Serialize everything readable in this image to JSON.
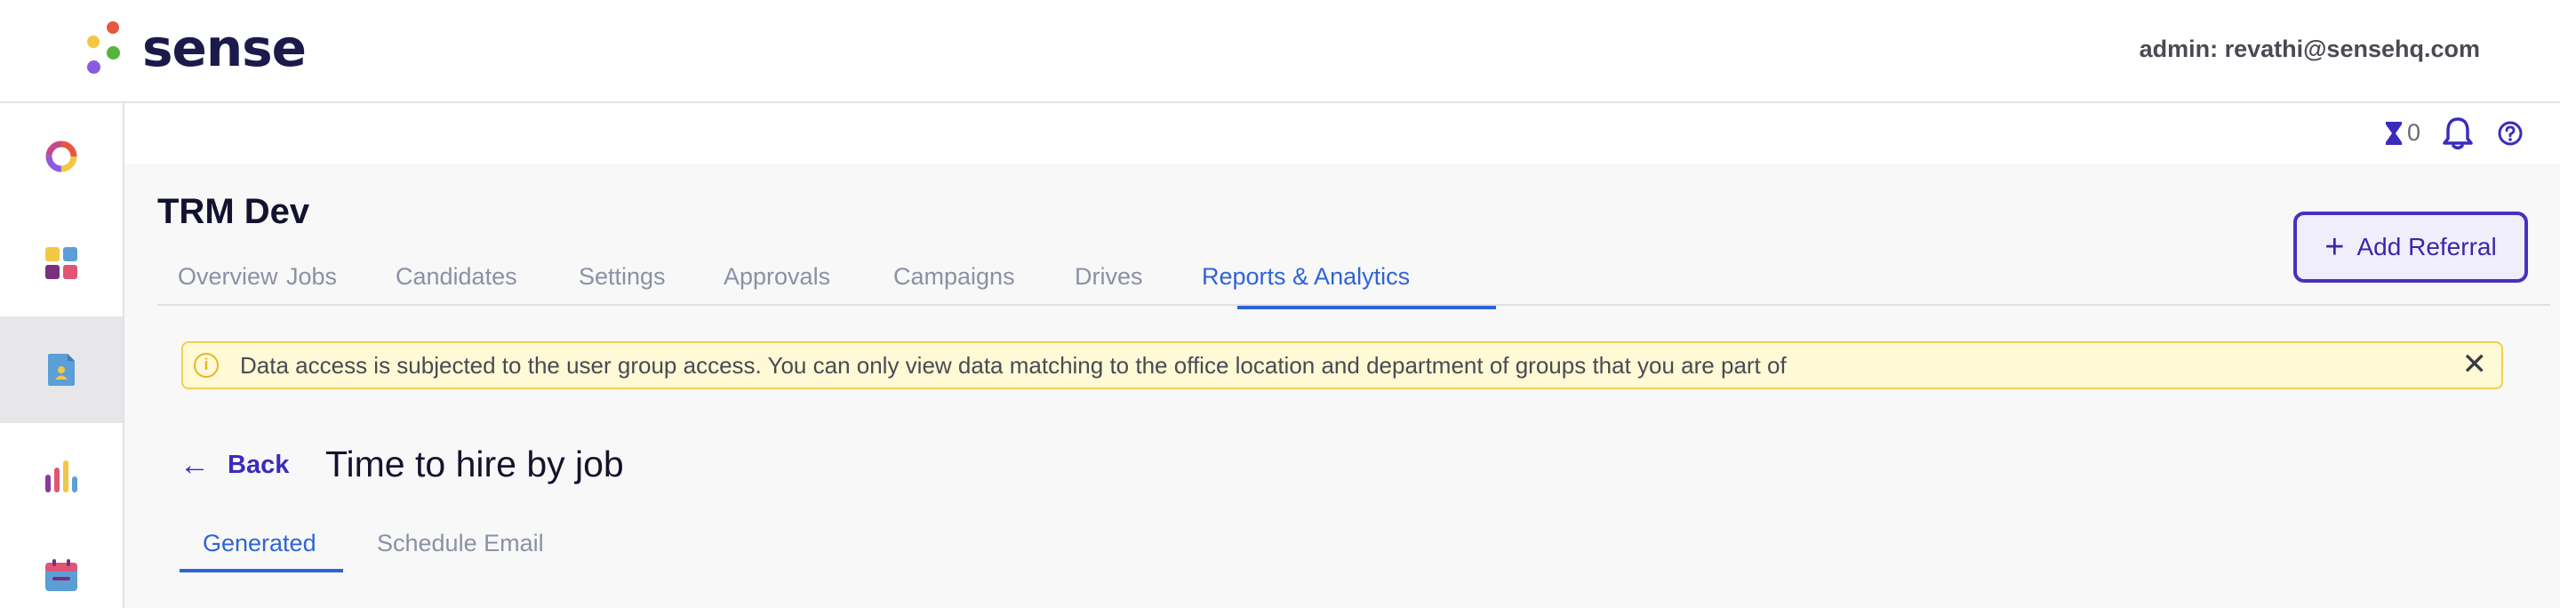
{
  "brand": {
    "name": "sense"
  },
  "header": {
    "admin_label": "admin: revathi@sensehq.com"
  },
  "sidebar": {
    "items": [
      {
        "icon": "ring-chart-icon",
        "active": false
      },
      {
        "icon": "grid-apps-icon",
        "active": false
      },
      {
        "icon": "document-user-icon",
        "active": true
      },
      {
        "icon": "bar-chart-icon",
        "active": false
      },
      {
        "icon": "calendar-icon",
        "active": false
      }
    ]
  },
  "utility": {
    "hourglass_count": "0",
    "icons": [
      "hourglass-icon",
      "bell-icon",
      "help-icon"
    ]
  },
  "project": {
    "title": "TRM Dev"
  },
  "tabs": [
    {
      "label": "Overview"
    },
    {
      "label": "Jobs"
    },
    {
      "label": "Candidates"
    },
    {
      "label": "Settings"
    },
    {
      "label": "Approvals"
    },
    {
      "label": "Campaigns"
    },
    {
      "label": "Drives"
    },
    {
      "label": "Reports & Analytics",
      "active": true
    }
  ],
  "actions": {
    "add_referral": "Add Referral"
  },
  "notice": {
    "text": "Data access is subjected to the user group access. You can only view data matching to the office location and department of groups that you are part of"
  },
  "report": {
    "back_label": "Back",
    "title": "Time to hire by job"
  },
  "subtabs": [
    {
      "label": "Generated",
      "active": true
    },
    {
      "label": "Schedule Email",
      "active": false
    }
  ],
  "colors": {
    "accent_blue": "#2d64d8",
    "brand_purple": "#4b2fc1",
    "notice_bg": "#fff9d6",
    "notice_border": "#efd04c"
  }
}
